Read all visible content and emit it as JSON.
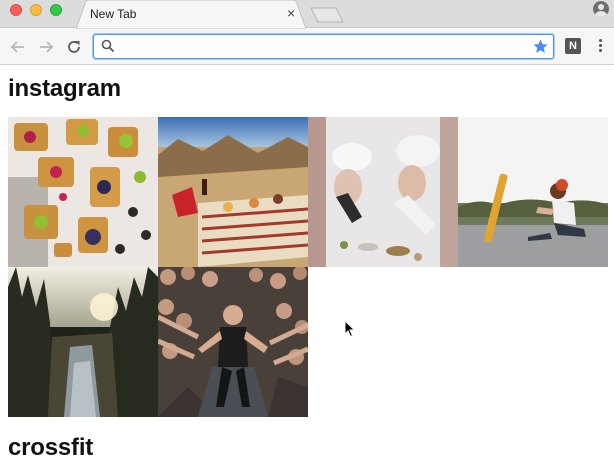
{
  "window": {
    "tab_title": "New Tab",
    "tab_close": "×"
  },
  "toolbar": {
    "omnibox_value": "",
    "extension_label": "N",
    "icons": [
      "back-arrow-icon",
      "forward-arrow-icon",
      "reload-icon",
      "search-icon",
      "star-icon",
      "more-vert-icon"
    ]
  },
  "page": {
    "sections": [
      {
        "title": "instagram",
        "photos": [
          {
            "subject": "waffle-pops-photo"
          },
          {
            "subject": "desert-picnic-photo"
          },
          {
            "subject": "chefs-plating-photo"
          },
          {
            "subject": "longboard-skater-photo"
          },
          {
            "subject": "forest-canyon-photo"
          },
          {
            "subject": "crowd-performer-photo"
          }
        ]
      },
      {
        "title": "crossfit"
      }
    ]
  },
  "colors": {
    "accent_blue": "#4d90fe",
    "star_blue": "#4c8bf5",
    "close_red": "#fc605c",
    "minimize_yellow": "#fdbc40",
    "zoom_green": "#34c84a"
  }
}
